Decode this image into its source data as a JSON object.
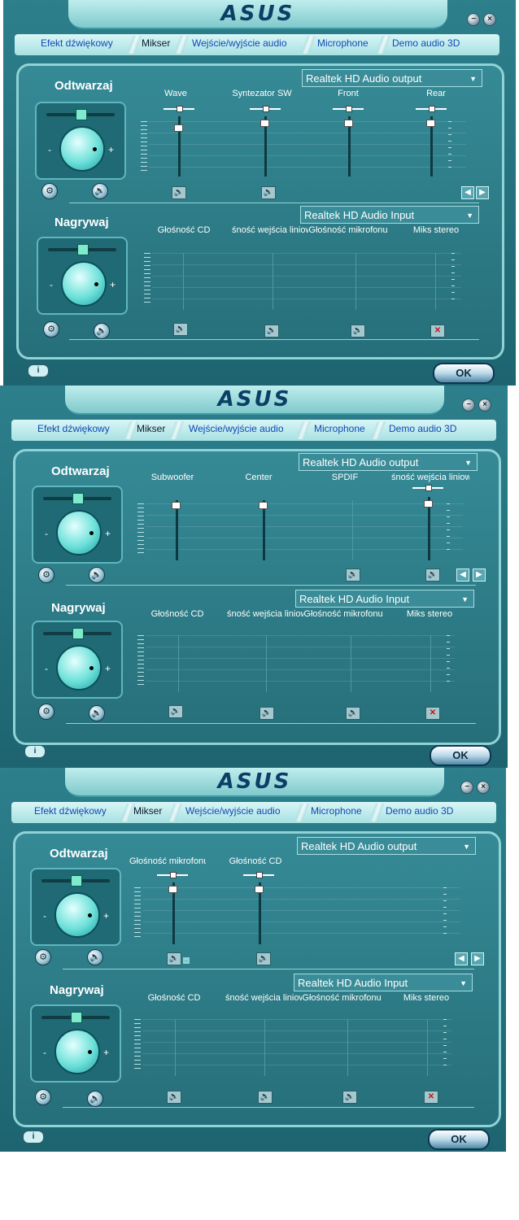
{
  "brand": "ASUS",
  "tabs": [
    "Efekt dźwiękowy",
    "Mikser",
    "Wejście/wyjście audio",
    "Microphone",
    "Demo audio 3D"
  ],
  "active_tab": "Mikser",
  "window_buttons": {
    "minimize": "−",
    "close": "×"
  },
  "ok_label": "OK",
  "info_label": "i",
  "panels": [
    {
      "playback": {
        "title": "Odtwarzaj",
        "device": "Realtek HD Audio output",
        "channels": [
          "Wave",
          "Syntezator SW",
          "Front",
          "Rear"
        ]
      },
      "record": {
        "title": "Nagrywaj",
        "device": "Realtek HD Audio Input",
        "channels": [
          "Głośność CD",
          "śność wejścia liniow",
          "Głośność mikrofonu",
          "Miks stereo"
        ]
      }
    },
    {
      "playback": {
        "title": "Odtwarzaj",
        "device": "Realtek HD Audio output",
        "channels": [
          "Subwoofer",
          "Center",
          "SPDIF",
          "śność wejścia liniow"
        ]
      },
      "record": {
        "title": "Nagrywaj",
        "device": "Realtek HD Audio Input",
        "channels": [
          "Głośność CD",
          "śność wejścia liniow",
          "Głośność mikrofonu",
          "Miks stereo"
        ]
      }
    },
    {
      "playback": {
        "title": "Odtwarzaj",
        "device": "Realtek HD Audio output",
        "channels": [
          "Głośność mikrofonu",
          "Głośność CD"
        ]
      },
      "record": {
        "title": "Nagrywaj",
        "device": "Realtek HD Audio Input",
        "channels": [
          "Głośność CD",
          "śność wejścia liniow",
          "Głośność mikrofonu",
          "Miks stereo"
        ]
      }
    }
  ]
}
